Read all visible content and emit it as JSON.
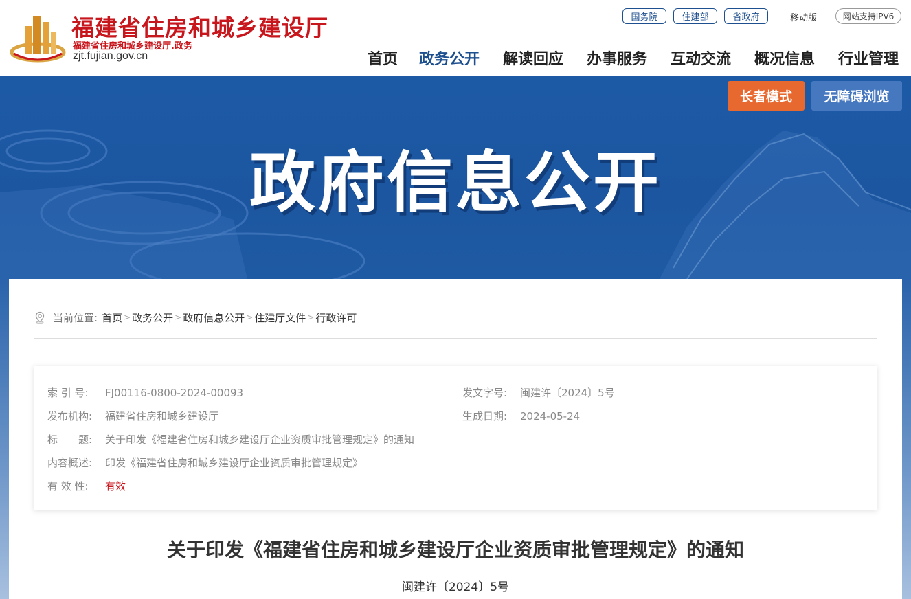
{
  "header": {
    "site_title": "福建省住房和城乡建设厅",
    "site_subtitle": "福建省住房和城乡建设厅.政务",
    "site_domain": "zjt.fujian.gov.cn",
    "top_links": [
      "国务院",
      "住建部",
      "省政府"
    ],
    "mobile_label": "移动版",
    "ipv6_label": "网站支持IPV6",
    "nav": [
      {
        "label": "首页",
        "active": false
      },
      {
        "label": "政务公开",
        "active": true
      },
      {
        "label": "解读回应",
        "active": false
      },
      {
        "label": "办事服务",
        "active": false
      },
      {
        "label": "互动交流",
        "active": false
      },
      {
        "label": "概况信息",
        "active": false
      },
      {
        "label": "行业管理",
        "active": false
      }
    ]
  },
  "banner": {
    "title": "政府信息公开",
    "elder_mode": "长者模式",
    "accessibility": "无障碍浏览"
  },
  "breadcrumb": {
    "label": "当前位置:",
    "items": [
      "首页",
      "政务公开",
      "政府信息公开",
      "住建厅文件",
      "行政许可"
    ],
    "separator": ">"
  },
  "meta": {
    "index_no_key": "索 引 号:",
    "index_no": "FJ00116-0800-2024-00093",
    "doc_no_key": "发文字号:",
    "doc_no": "闽建许〔2024〕5号",
    "publisher_key": "发布机构:",
    "publisher": "福建省住房和城乡建设厅",
    "date_key": "生成日期:",
    "date": "2024-05-24",
    "title_key": "标　　题:",
    "title": "关于印发《福建省住房和城乡建设厅企业资质审批管理规定》的通知",
    "summary_key": "内容概述:",
    "summary": "印发《福建省住房和城乡建设厅企业资质审批管理规定》",
    "validity_key": "有 效 性:",
    "validity": "有效"
  },
  "document": {
    "title": "关于印发《福建省住房和城乡建设厅企业资质审批管理规定》的通知",
    "number": "闽建许〔2024〕5号"
  },
  "colors": {
    "brand_red": "#c8161d",
    "brand_blue": "#1e4f8f",
    "elder_orange": "#e8692f",
    "access_blue": "#4678c0"
  }
}
